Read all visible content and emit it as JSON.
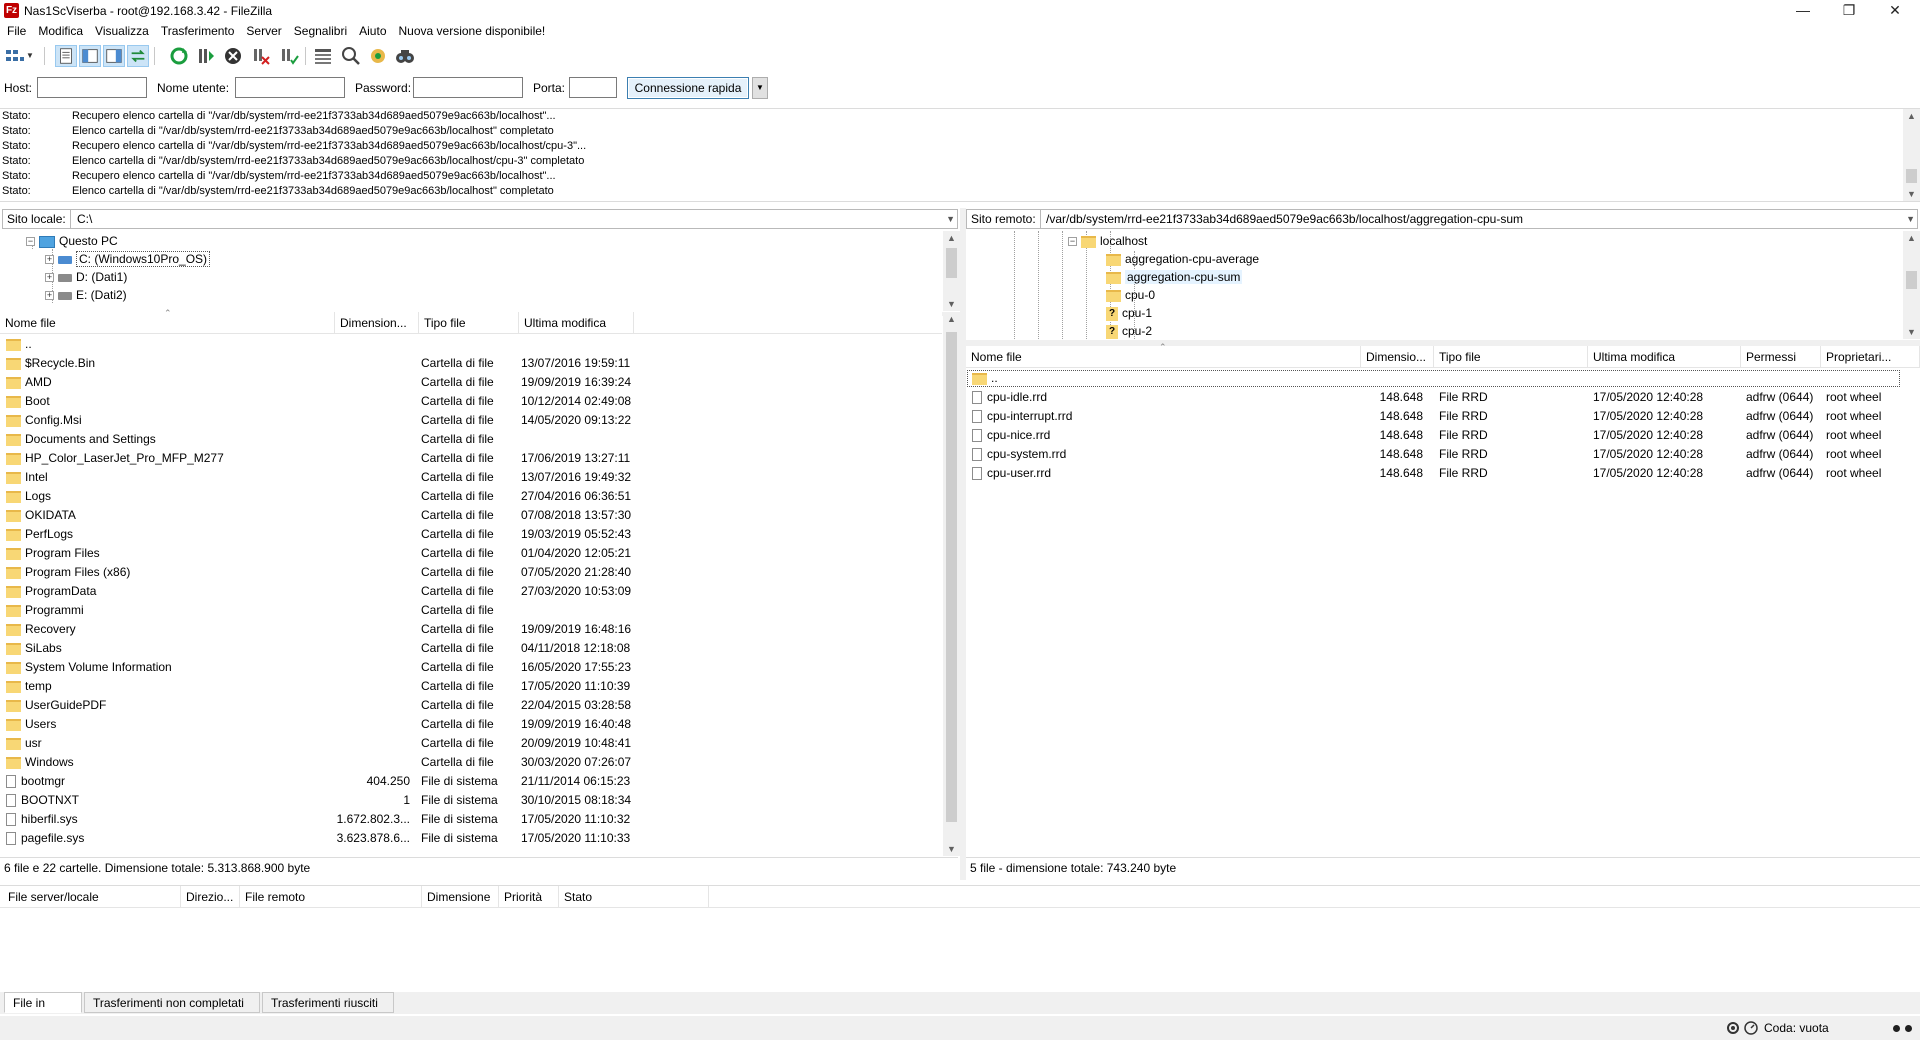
{
  "window": {
    "title": "Nas1ScViserba - root@192.168.3.42 - FileZilla",
    "app_icon_letter": "Fz",
    "controls": [
      "minimize",
      "restore",
      "close"
    ]
  },
  "menu": {
    "items": [
      "File",
      "Modifica",
      "Visualizza",
      "Trasferimento",
      "Server",
      "Segnalibri",
      "Aiuto",
      "Nuova versione disponibile!"
    ]
  },
  "toolbar": {
    "icons": [
      "site-manager-icon",
      "dropdown-icon",
      "toggle-log-icon",
      "toggle-local-tree-icon",
      "toggle-remote-tree-icon",
      "toggle-queue-icon",
      "refresh-icon",
      "process-queue-icon",
      "cancel-icon",
      "disconnect-icon",
      "reconnect-icon",
      "filter-icon",
      "compare-icon",
      "sync-browse-icon",
      "search-icon"
    ]
  },
  "quickconnect": {
    "host_label": "Host:",
    "host_value": "",
    "user_label": "Nome utente:",
    "user_value": "",
    "password_label": "Password:",
    "password_value": "",
    "port_label": "Porta:",
    "port_value": "",
    "connect_label": "Connessione rapida",
    "dropdown_label": "▼"
  },
  "log": {
    "lines": [
      {
        "label": "Stato:",
        "msg": "Recupero elenco cartella di \"/var/db/system/rrd-ee21f3733ab34d689aed5079e9ac663b/localhost\"..."
      },
      {
        "label": "Stato:",
        "msg": "Elenco cartella di \"/var/db/system/rrd-ee21f3733ab34d689aed5079e9ac663b/localhost\" completato"
      },
      {
        "label": "Stato:",
        "msg": "Recupero elenco cartella di \"/var/db/system/rrd-ee21f3733ab34d689aed5079e9ac663b/localhost/cpu-3\"..."
      },
      {
        "label": "Stato:",
        "msg": "Elenco cartella di \"/var/db/system/rrd-ee21f3733ab34d689aed5079e9ac663b/localhost/cpu-3\" completato"
      },
      {
        "label": "Stato:",
        "msg": "Recupero elenco cartella di \"/var/db/system/rrd-ee21f3733ab34d689aed5079e9ac663b/localhost\"..."
      },
      {
        "label": "Stato:",
        "msg": "Elenco cartella di \"/var/db/system/rrd-ee21f3733ab34d689aed5079e9ac663b/localhost\" completato"
      }
    ]
  },
  "local": {
    "site_label": "Sito locale:",
    "path": "C:\\",
    "tree": [
      {
        "label": "Questo PC",
        "exp": "−",
        "icon": "pc"
      },
      {
        "label": "C: (Windows10Pro_OS)",
        "exp": "+",
        "icon": "drive-c"
      },
      {
        "label": "D: (Dati1)",
        "exp": "+",
        "icon": "drive"
      },
      {
        "label": "E: (Dati2)",
        "exp": "+",
        "icon": "drive"
      }
    ],
    "columns": [
      "Nome file",
      "Dimension...",
      "Tipo file",
      "Ultima modifica"
    ],
    "files": [
      {
        "name": "..",
        "size": "",
        "type": "",
        "date": "",
        "kind": "folder"
      },
      {
        "name": "$Recycle.Bin",
        "size": "",
        "type": "Cartella di file",
        "date": "13/07/2016 19:59:11",
        "kind": "folder"
      },
      {
        "name": "AMD",
        "size": "",
        "type": "Cartella di file",
        "date": "19/09/2019 16:39:24",
        "kind": "folder"
      },
      {
        "name": "Boot",
        "size": "",
        "type": "Cartella di file",
        "date": "10/12/2014 02:49:08",
        "kind": "folder"
      },
      {
        "name": "Config.Msi",
        "size": "",
        "type": "Cartella di file",
        "date": "14/05/2020 09:13:22",
        "kind": "folder"
      },
      {
        "name": "Documents and Settings",
        "size": "",
        "type": "Cartella di file",
        "date": "",
        "kind": "folder"
      },
      {
        "name": "HP_Color_LaserJet_Pro_MFP_M277",
        "size": "",
        "type": "Cartella di file",
        "date": "17/06/2019 13:27:11",
        "kind": "folder"
      },
      {
        "name": "Intel",
        "size": "",
        "type": "Cartella di file",
        "date": "13/07/2016 19:49:32",
        "kind": "folder"
      },
      {
        "name": "Logs",
        "size": "",
        "type": "Cartella di file",
        "date": "27/04/2016 06:36:51",
        "kind": "folder"
      },
      {
        "name": "OKIDATA",
        "size": "",
        "type": "Cartella di file",
        "date": "07/08/2018 13:57:30",
        "kind": "folder"
      },
      {
        "name": "PerfLogs",
        "size": "",
        "type": "Cartella di file",
        "date": "19/03/2019 05:52:43",
        "kind": "folder"
      },
      {
        "name": "Program Files",
        "size": "",
        "type": "Cartella di file",
        "date": "01/04/2020 12:05:21",
        "kind": "folder"
      },
      {
        "name": "Program Files (x86)",
        "size": "",
        "type": "Cartella di file",
        "date": "07/05/2020 21:28:40",
        "kind": "folder"
      },
      {
        "name": "ProgramData",
        "size": "",
        "type": "Cartella di file",
        "date": "27/03/2020 10:53:09",
        "kind": "folder"
      },
      {
        "name": "Programmi",
        "size": "",
        "type": "Cartella di file",
        "date": "",
        "kind": "folder"
      },
      {
        "name": "Recovery",
        "size": "",
        "type": "Cartella di file",
        "date": "19/09/2019 16:48:16",
        "kind": "folder"
      },
      {
        "name": "SiLabs",
        "size": "",
        "type": "Cartella di file",
        "date": "04/11/2018 12:18:08",
        "kind": "folder"
      },
      {
        "name": "System Volume Information",
        "size": "",
        "type": "Cartella di file",
        "date": "16/05/2020 17:55:23",
        "kind": "folder"
      },
      {
        "name": "temp",
        "size": "",
        "type": "Cartella di file",
        "date": "17/05/2020 11:10:39",
        "kind": "folder"
      },
      {
        "name": "UserGuidePDF",
        "size": "",
        "type": "Cartella di file",
        "date": "22/04/2015 03:28:58",
        "kind": "folder"
      },
      {
        "name": "Users",
        "size": "",
        "type": "Cartella di file",
        "date": "19/09/2019 16:40:48",
        "kind": "folder"
      },
      {
        "name": "usr",
        "size": "",
        "type": "Cartella di file",
        "date": "20/09/2019 10:48:41",
        "kind": "folder"
      },
      {
        "name": "Windows",
        "size": "",
        "type": "Cartella di file",
        "date": "30/03/2020 07:26:07",
        "kind": "folder"
      },
      {
        "name": "bootmgr",
        "size": "404.250",
        "type": "File di sistema",
        "date": "21/11/2014 06:15:23",
        "kind": "file"
      },
      {
        "name": "BOOTNXT",
        "size": "1",
        "type": "File di sistema",
        "date": "30/10/2015 08:18:34",
        "kind": "file"
      },
      {
        "name": "hiberfil.sys",
        "size": "1.672.802.3...",
        "type": "File di sistema",
        "date": "17/05/2020 11:10:32",
        "kind": "file"
      },
      {
        "name": "pagefile.sys",
        "size": "3.623.878.6...",
        "type": "File di sistema",
        "date": "17/05/2020 11:10:33",
        "kind": "file"
      }
    ],
    "status": "6 file e 22 cartelle. Dimensione totale: 5.313.868.900 byte"
  },
  "remote": {
    "site_label": "Sito remoto:",
    "path": "/var/db/system/rrd-ee21f3733ab34d689aed5079e9ac663b/localhost/aggregation-cpu-sum",
    "tree": [
      {
        "label": "localhost",
        "exp": "−",
        "icon": "folder",
        "depth": 0
      },
      {
        "label": "aggregation-cpu-average",
        "exp": "",
        "icon": "folder",
        "depth": 1
      },
      {
        "label": "aggregation-cpu-sum",
        "exp": "",
        "icon": "folder",
        "depth": 1
      },
      {
        "label": "cpu-0",
        "exp": "",
        "icon": "folder",
        "depth": 1
      },
      {
        "label": "cpu-1",
        "exp": "",
        "icon": "question",
        "depth": 1
      },
      {
        "label": "cpu-2",
        "exp": "",
        "icon": "question",
        "depth": 1
      }
    ],
    "columns": [
      "Nome file",
      "Dimensio...",
      "Tipo file",
      "Ultima modifica",
      "Permessi",
      "Proprietari..."
    ],
    "files": [
      {
        "name": "..",
        "size": "",
        "type": "",
        "date": "",
        "perm": "",
        "owner": "",
        "kind": "folder"
      },
      {
        "name": "cpu-idle.rrd",
        "size": "148.648",
        "type": "File RRD",
        "date": "17/05/2020 12:40:28",
        "perm": "adfrw (0644)",
        "owner": "root wheel",
        "kind": "file"
      },
      {
        "name": "cpu-interrupt.rrd",
        "size": "148.648",
        "type": "File RRD",
        "date": "17/05/2020 12:40:28",
        "perm": "adfrw (0644)",
        "owner": "root wheel",
        "kind": "file"
      },
      {
        "name": "cpu-nice.rrd",
        "size": "148.648",
        "type": "File RRD",
        "date": "17/05/2020 12:40:28",
        "perm": "adfrw (0644)",
        "owner": "root wheel",
        "kind": "file"
      },
      {
        "name": "cpu-system.rrd",
        "size": "148.648",
        "type": "File RRD",
        "date": "17/05/2020 12:40:28",
        "perm": "adfrw (0644)",
        "owner": "root wheel",
        "kind": "file"
      },
      {
        "name": "cpu-user.rrd",
        "size": "148.648",
        "type": "File RRD",
        "date": "17/05/2020 12:40:28",
        "perm": "adfrw (0644)",
        "owner": "root wheel",
        "kind": "file"
      }
    ],
    "status": "5 file - dimensione totale: 743.240 byte"
  },
  "queue": {
    "columns": [
      "File server/locale",
      "Direzio...",
      "File remoto",
      "Dimensione",
      "Priorità",
      "Stato"
    ],
    "tabs": [
      "File in coda",
      "Trasferimenti non completati",
      "Trasferimenti riusciti"
    ],
    "status": "Coda: vuota"
  }
}
